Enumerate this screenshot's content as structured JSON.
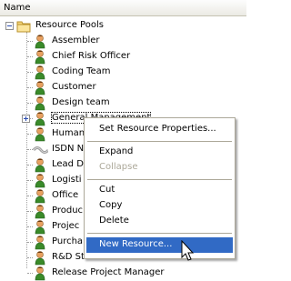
{
  "header": {
    "name_label": "Name"
  },
  "tree": {
    "root": {
      "label": "Resource Pools",
      "icon": "folder-icon"
    },
    "items": [
      {
        "label": "Assembler",
        "icon": "person-icon"
      },
      {
        "label": "Chief Risk Officer",
        "icon": "person-icon"
      },
      {
        "label": "Coding Team",
        "icon": "person-icon"
      },
      {
        "label": "Customer",
        "icon": "person-icon"
      },
      {
        "label": "Design team",
        "icon": "person-icon"
      },
      {
        "label": "General Management",
        "icon": "person-icon",
        "expandable": true
      },
      {
        "label": "Human",
        "icon": "person-icon"
      },
      {
        "label": "ISDN N",
        "icon": "cable-icon"
      },
      {
        "label": "Lead D",
        "icon": "person-icon"
      },
      {
        "label": "Logisti",
        "icon": "person-icon"
      },
      {
        "label": "Office",
        "icon": "person-icon"
      },
      {
        "label": "Produc",
        "icon": "person-icon"
      },
      {
        "label": "Projec",
        "icon": "person-icon"
      },
      {
        "label": "Purcha",
        "icon": "person-icon"
      },
      {
        "label": "R&D Stan",
        "icon": "person-icon"
      },
      {
        "label": "Release Project Manager",
        "icon": "person-icon"
      }
    ]
  },
  "context_menu": {
    "set_properties": "Set Resource Properties...",
    "expand": "Expand",
    "collapse": "Collapse",
    "cut": "Cut",
    "copy": "Copy",
    "delete": "Delete",
    "new_resource": "New Resource..."
  },
  "colors": {
    "selection": "#316ac5",
    "disabled_text": "#aca899",
    "person_head": "#e8a060",
    "person_body": "#3a8a2a"
  }
}
